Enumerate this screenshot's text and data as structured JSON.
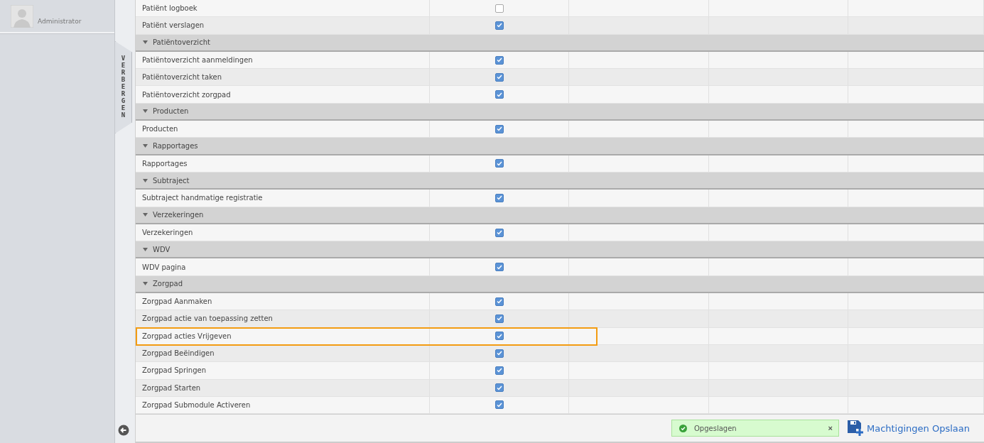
{
  "user": {
    "role": "Administrator"
  },
  "sidebar_toggle": {
    "label": "VERBERGEN"
  },
  "rows": [
    {
      "kind": "item",
      "label": "Patiënt logboek",
      "checked": false,
      "highlighted": false
    },
    {
      "kind": "item",
      "label": "Patiënt verslagen",
      "checked": true,
      "highlighted": false
    },
    {
      "kind": "group",
      "label": "Patiëntoverzicht",
      "expanded": true
    },
    {
      "kind": "item",
      "label": "Patiëntoverzicht aanmeldingen",
      "checked": true,
      "highlighted": false
    },
    {
      "kind": "item",
      "label": "Patiëntoverzicht taken",
      "checked": true,
      "highlighted": false
    },
    {
      "kind": "item",
      "label": "Patiëntoverzicht zorgpad",
      "checked": true,
      "highlighted": false
    },
    {
      "kind": "group",
      "label": "Producten",
      "expanded": true
    },
    {
      "kind": "item",
      "label": "Producten",
      "checked": true,
      "highlighted": false
    },
    {
      "kind": "group",
      "label": "Rapportages",
      "expanded": true
    },
    {
      "kind": "item",
      "label": "Rapportages",
      "checked": true,
      "highlighted": false
    },
    {
      "kind": "group",
      "label": "Subtraject",
      "expanded": true
    },
    {
      "kind": "item",
      "label": "Subtraject handmatige registratie",
      "checked": true,
      "highlighted": false
    },
    {
      "kind": "group",
      "label": "Verzekeringen",
      "expanded": true
    },
    {
      "kind": "item",
      "label": "Verzekeringen",
      "checked": true,
      "highlighted": false
    },
    {
      "kind": "group",
      "label": "WDV",
      "expanded": true
    },
    {
      "kind": "item",
      "label": "WDV pagina",
      "checked": true,
      "highlighted": false
    },
    {
      "kind": "group",
      "label": "Zorgpad",
      "expanded": true
    },
    {
      "kind": "item",
      "label": "Zorgpad Aanmaken",
      "checked": true,
      "highlighted": false
    },
    {
      "kind": "item",
      "label": "Zorgpad actie van toepassing zetten",
      "checked": true,
      "highlighted": false
    },
    {
      "kind": "item",
      "label": "Zorgpad acties Vrijgeven",
      "checked": true,
      "highlighted": true
    },
    {
      "kind": "item",
      "label": "Zorgpad Beëindigen",
      "checked": true,
      "highlighted": false
    },
    {
      "kind": "item",
      "label": "Zorgpad Springen",
      "checked": true,
      "highlighted": false
    },
    {
      "kind": "item",
      "label": "Zorgpad Starten",
      "checked": true,
      "highlighted": false
    },
    {
      "kind": "item",
      "label": "Zorgpad Submodule Activeren",
      "checked": true,
      "highlighted": false
    }
  ],
  "notification": {
    "message": "Opgeslagen",
    "close": "×"
  },
  "save_button": {
    "label": "Machtigingen Opslaan"
  }
}
